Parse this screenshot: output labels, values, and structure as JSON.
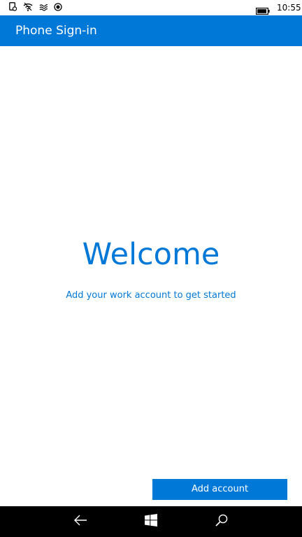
{
  "status_bar": {
    "time": "10:55",
    "icons": [
      "notification-icon",
      "wifi-icon",
      "vibrate-icon",
      "location-icon",
      "battery-icon"
    ]
  },
  "header": {
    "title": "Phone Sign-in"
  },
  "main": {
    "heading": "Welcome",
    "subtitle": "Add your work account to get started",
    "add_account_label": "Add account"
  },
  "nav_bar": {
    "icons": [
      "back-arrow-icon",
      "windows-logo-icon",
      "search-icon"
    ]
  },
  "colors": {
    "accent": "#0078d7",
    "background": "#ffffff",
    "nav_bar": "#000000"
  }
}
